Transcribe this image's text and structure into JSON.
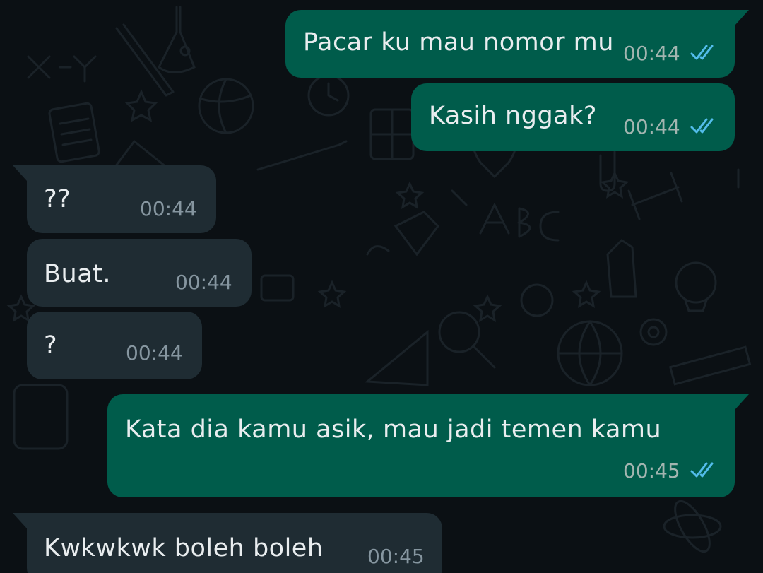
{
  "messages": [
    {
      "direction": "outgoing",
      "text": "Pacar ku mau nomor mu",
      "time": "00:44",
      "status_icon": "double-check-read-icon"
    },
    {
      "direction": "outgoing",
      "text": "Kasih nggak?",
      "time": "00:44",
      "status_icon": "double-check-read-icon"
    },
    {
      "direction": "incoming",
      "text": "??",
      "time": "00:44"
    },
    {
      "direction": "incoming",
      "text": "Buat.",
      "time": "00:44"
    },
    {
      "direction": "incoming",
      "text": "?",
      "time": "00:44"
    },
    {
      "direction": "outgoing",
      "text": "Kata dia kamu asik, mau jadi temen kamu",
      "time": "00:45",
      "status_icon": "double-check-read-icon"
    },
    {
      "direction": "incoming",
      "text": "Kwkwkwk boleh boleh",
      "time": "00:45"
    }
  ],
  "colors": {
    "background": "#0b1014",
    "outgoing_bubble": "#005c4b",
    "incoming_bubble": "#1f2c33",
    "text": "#e9edef",
    "read_tick": "#53bdeb"
  }
}
